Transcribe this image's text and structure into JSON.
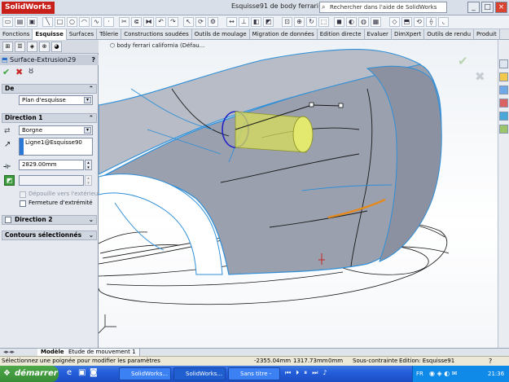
{
  "app": {
    "logo": "SolidWorks",
    "title": "Esquisse91 de body ferrari calif...",
    "search_placeholder": "Rechercher dans l'aide de SolidWorks",
    "win_controls": [
      "_",
      "□",
      "×"
    ]
  },
  "command_tabs": [
    "Fonctions",
    "Esquisse",
    "Surfaces",
    "Tôlerie",
    "Constructions soudées",
    "Outils de moulage",
    "Migration de données",
    "Edition directe",
    "Evaluer",
    "DimXpert",
    "Outils de rendu",
    "Produit"
  ],
  "feature_manager": {
    "feature_title": "Surface-Extrusion29",
    "help": "?",
    "sections": {
      "from": {
        "label": "De",
        "value": "Plan d'esquisse"
      },
      "direction1": {
        "label": "Direction 1",
        "end_condition": "Borgne",
        "direction_ref": "Ligne1@Esquisse90",
        "depth": "2829.00mm",
        "draft_outward": "Dépouille vers l'extérieur",
        "cap_end": "Fermeture d'extrémité"
      },
      "direction2": {
        "label": "Direction 2"
      },
      "contours": {
        "label": "Contours sélectionnés"
      }
    }
  },
  "viewport": {
    "tree_label": "body ferrari california (Défau..."
  },
  "bottom_tabs": [
    "Modèle",
    "Etude de mouvement 1"
  ],
  "status": {
    "message": "Sélectionnez une poignée pour modifier les paramètres",
    "x": "-2355.04mm",
    "y": "1317.73mm",
    "z": "0mm",
    "state": "Sous-contrainte",
    "edition": "Edition: Esquisse91"
  },
  "taskbar": {
    "start": "démarrer",
    "buttons": [
      "SolidWorks...",
      "SolidWorks...",
      "Sans titre -"
    ],
    "lang": "FR",
    "clock": "21:36"
  },
  "colors": {
    "surface": "#9aa0ad",
    "edge": "#2f8fd8",
    "cylinder": "#d8df5a",
    "ok": "#3aa63a",
    "cancel": "#c62828"
  }
}
